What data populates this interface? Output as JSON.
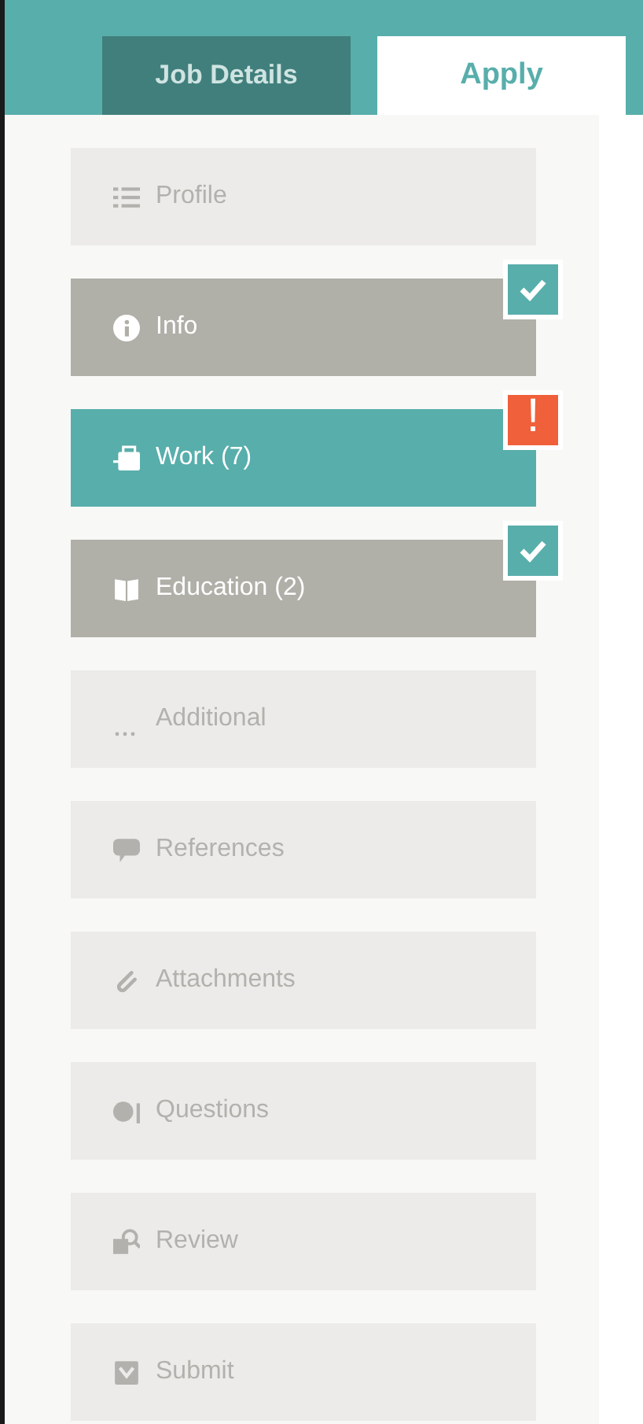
{
  "tabs": [
    {
      "label": "Job Details",
      "selected": false
    },
    {
      "label": "Apply",
      "selected": true
    }
  ],
  "steps": [
    {
      "label": "Profile",
      "selected": false,
      "completed": false,
      "alert": false
    },
    {
      "label": "Info",
      "selected": false,
      "completed": true,
      "alert": false
    },
    {
      "label": "Work (7)",
      "selected": true,
      "completed": false,
      "alert": true,
      "alert_text": "!"
    },
    {
      "label": "Education (2)",
      "selected": false,
      "completed": true,
      "alert": false
    },
    {
      "label": "Additional",
      "selected": false,
      "completed": false,
      "alert": false
    },
    {
      "label": "References",
      "selected": false,
      "completed": false,
      "alert": false
    },
    {
      "label": "Attachments",
      "selected": false,
      "completed": false,
      "alert": false
    },
    {
      "label": "Questions",
      "selected": false,
      "completed": false,
      "alert": false
    },
    {
      "label": "Review",
      "selected": false,
      "completed": false,
      "alert": false
    },
    {
      "label": "Submit",
      "selected": false,
      "completed": false,
      "alert": false
    }
  ]
}
